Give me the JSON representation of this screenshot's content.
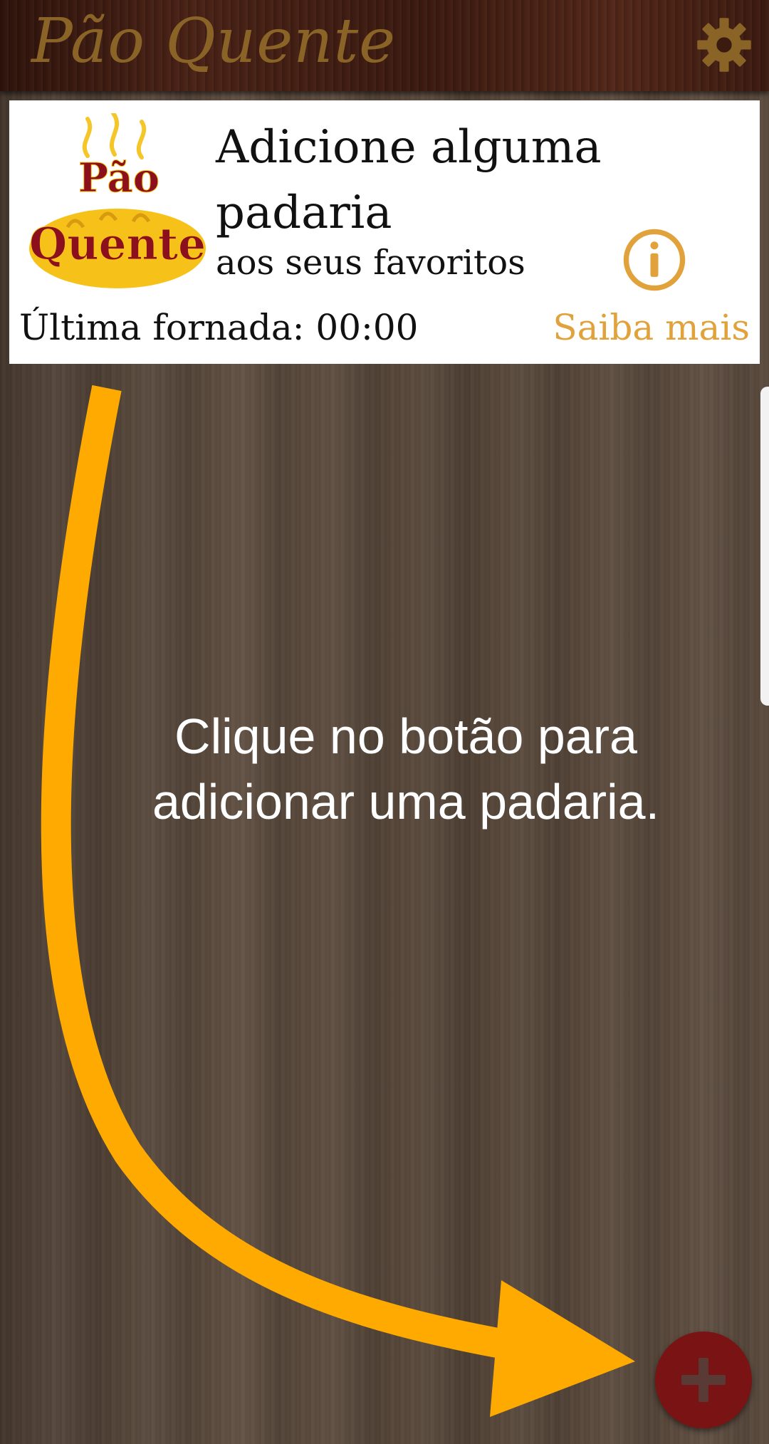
{
  "header": {
    "title": "Pão Quente",
    "settings_icon": "gear-icon"
  },
  "card": {
    "logo_line1": "Pão",
    "logo_line2": "Quente",
    "title": "Adicione alguma padaria",
    "subtitle": "aos seus favoritos",
    "last_batch": "Última fornada: 00:00",
    "info_icon": "info-icon",
    "more_link": "Saiba mais"
  },
  "instruction": {
    "line1": "Clique no botão para",
    "line2": "adicionar uma padaria."
  },
  "fab": {
    "icon": "plus-icon"
  },
  "colors": {
    "accent": "#e2a23b",
    "arrow": "#ffaa00",
    "fab": "#7a1414",
    "header_title": "#8a6427",
    "logo_text": "#8b0f1c",
    "logo_bread": "#f6c21a"
  }
}
